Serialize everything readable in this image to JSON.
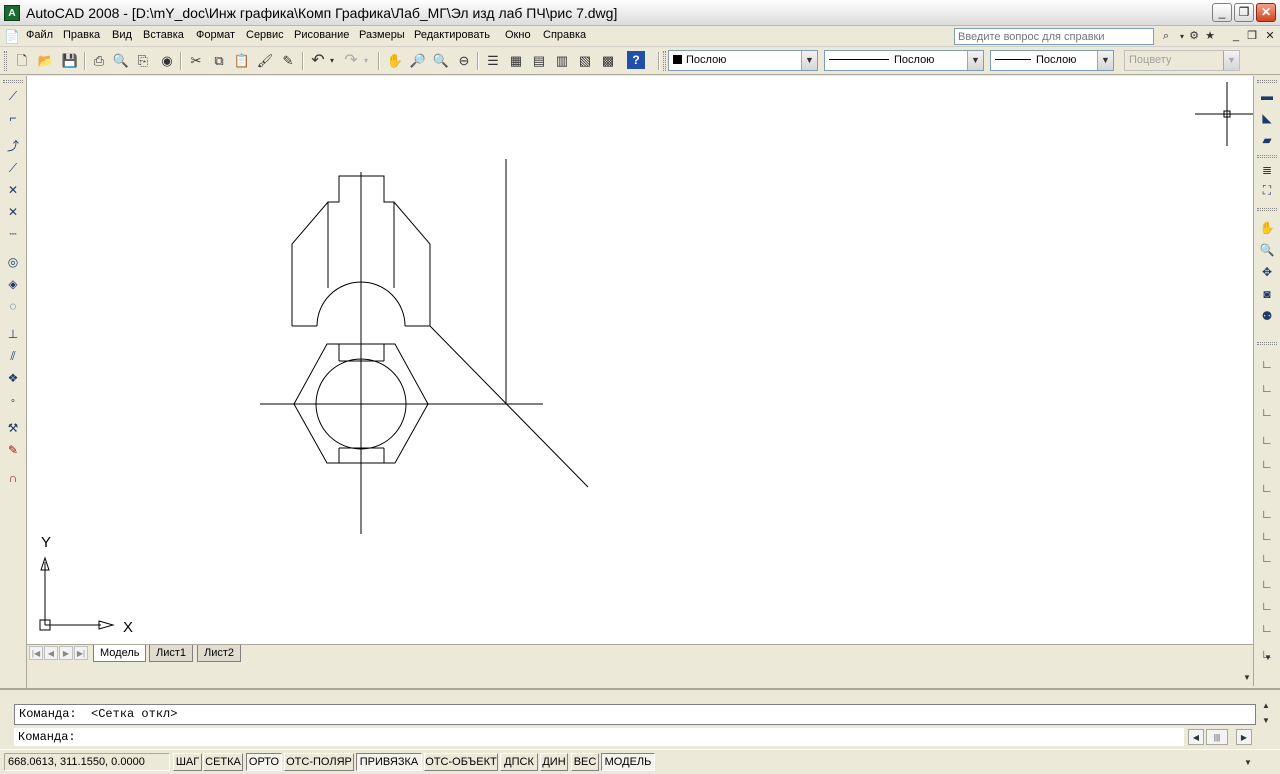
{
  "window": {
    "title": "AutoCAD 2008 - [D:\\mY_doc\\Инж графика\\Комп Графика\\Лаб_МГ\\Эл изд лаб ПЧ\\рис 7.dwg]",
    "app_icon_label": "A",
    "minimize_label": "_",
    "restore_label": "❐",
    "close_label": "✕"
  },
  "menu": {
    "items": [
      "Файл",
      "Правка",
      "Вид",
      "Вставка",
      "Формат",
      "Сервис",
      "Рисование",
      "Размеры",
      "Редактировать",
      "Окно",
      "Справка"
    ],
    "help_placeholder": "Введите вопрос для справки",
    "doc_minimize": "_",
    "doc_restore": "❐",
    "doc_close": "✕"
  },
  "properties": {
    "color_value": "Послою",
    "linetype_value": "Послою",
    "lineweight_value": "Послою",
    "plotstyle_value": "Поцвету"
  },
  "ucs": {
    "x_label": "X",
    "y_label": "Y"
  },
  "layout_tabs": {
    "model": "Модель",
    "sheet1": "Лист1",
    "sheet2": "Лист2"
  },
  "command_line": {
    "history_text": "Команда:  <Сетка откл>",
    "prompt_text": "Команда:"
  },
  "status": {
    "coordinates": "668.0613, 311.1550, 0.0000",
    "buttons": [
      {
        "label": "ШАГ",
        "state": "off"
      },
      {
        "label": "СЕТКА",
        "state": "off"
      },
      {
        "label": "ОРТО",
        "state": "on"
      },
      {
        "label": "ОТС-ПОЛЯР",
        "state": "off"
      },
      {
        "label": "ПРИВЯЗКА",
        "state": "on"
      },
      {
        "label": "ОТС-ОБЪЕКТ",
        "state": "off"
      },
      {
        "label": "ДПСК",
        "state": "off"
      },
      {
        "label": "ДИН",
        "state": "off"
      },
      {
        "label": "ВЕС",
        "state": "off"
      },
      {
        "label": "МОДЕЛЬ",
        "state": "on"
      }
    ]
  }
}
